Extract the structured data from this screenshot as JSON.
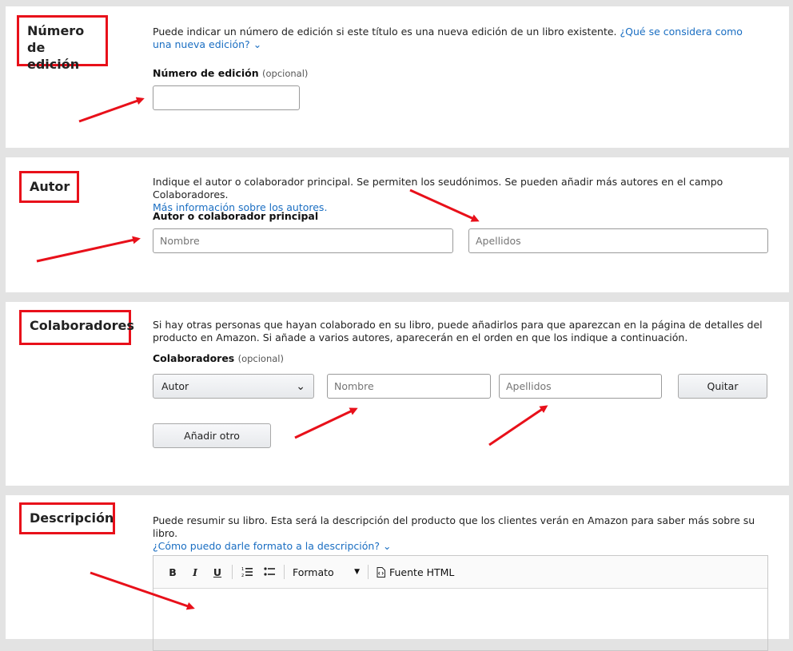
{
  "edition": {
    "heading": "Número de edición",
    "description": "Puede indicar un número de edición si este título es una nueva edición de un libro existente.",
    "help_link": "¿Qué se considera como una nueva edición?",
    "field_label": "Número de edición",
    "optional": "(opcional)",
    "input_value": ""
  },
  "author": {
    "heading": "Autor",
    "description": "Indique el autor o colaborador principal. Se permiten los seudónimos. Se pueden añadir más autores en el campo Colaboradores.",
    "help_link": "Más información sobre los autores.",
    "field_label": "Autor o colaborador principal",
    "first_name_placeholder": "Nombre",
    "last_name_placeholder": "Apellidos"
  },
  "contributors": {
    "heading": "Colaboradores",
    "description": "Si hay otras personas que hayan colaborado en su libro, puede añadirlos para que aparezcan en la página de detalles del producto en Amazon. Si añade a varios autores, aparecerán en el orden en que los indique a continuación.",
    "field_label": "Colaboradores",
    "optional": "(opcional)",
    "role_selected": "Autor",
    "first_name_placeholder": "Nombre",
    "last_name_placeholder": "Apellidos",
    "remove_label": "Quitar",
    "add_label": "Añadir otro"
  },
  "description": {
    "heading": "Descripción",
    "description": "Puede resumir su libro. Esta será la descripción del producto que los clientes verán en Amazon para saber más sobre su libro.",
    "help_link": "¿Cómo puedo darle formato a la descripción?",
    "toolbar": {
      "bold": "B",
      "italic": "I",
      "underline": "U",
      "format_label": "Formato",
      "html_label": "Fuente HTML"
    }
  },
  "colors": {
    "annotation_red": "#e8101a",
    "link_blue": "#1a6ec2"
  }
}
